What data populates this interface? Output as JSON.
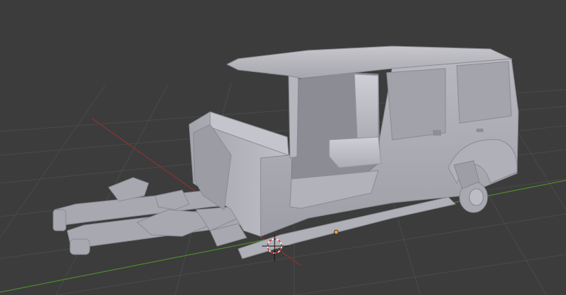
{
  "viewport": {
    "background": "#3c3c3c",
    "grid_color": "#4a4a4a",
    "x_axis_color": "#8a3434",
    "y_axis_color": "#4f8a2c",
    "model_color": "#b6b6be",
    "cursor_icon": "3d-cursor-icon",
    "origin_icon": "object-origin-icon"
  }
}
